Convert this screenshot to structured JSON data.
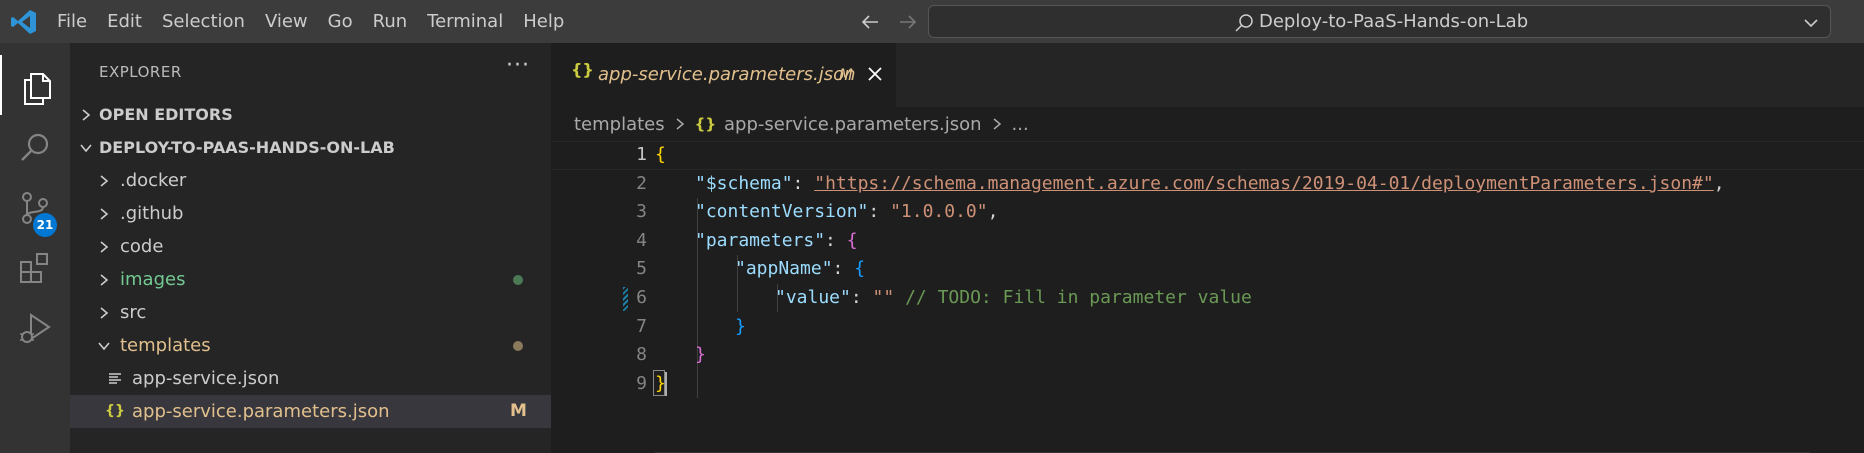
{
  "menu": [
    "File",
    "Edit",
    "Selection",
    "View",
    "Go",
    "Run",
    "Terminal",
    "Help"
  ],
  "command_center": {
    "title": "Deploy-to-PaaS-Hands-on-Lab"
  },
  "activity": {
    "scm_badge": "21"
  },
  "sidebar": {
    "title": "EXPLORER",
    "more": "···",
    "open_editors": "OPEN EDITORS",
    "workspace": "DEPLOY-TO-PAAS-HANDS-ON-LAB",
    "items": [
      {
        "label": ".docker",
        "color": "#cccccc"
      },
      {
        "label": ".github",
        "color": "#cccccc"
      },
      {
        "label": "code",
        "color": "#cccccc"
      },
      {
        "label": "images",
        "color": "#73c991"
      },
      {
        "label": "src",
        "color": "#cccccc"
      },
      {
        "label": "templates",
        "color": "#e2c08d"
      }
    ],
    "files": [
      {
        "label": "app-service.json"
      },
      {
        "label": "app-service.parameters.json",
        "status": "M"
      }
    ]
  },
  "tab": {
    "braces": "{}",
    "label": "app-service.parameters.json",
    "status": "M"
  },
  "breadcrumb": {
    "folder": "templates",
    "braces": "{}",
    "file": "app-service.parameters.json",
    "more": "..."
  },
  "code": {
    "line_numbers": [
      "1",
      "2",
      "3",
      "4",
      "5",
      "6",
      "7",
      "8",
      "9"
    ],
    "l1_open": "{",
    "l2_key": "\"$schema\"",
    "l2_colon": ": ",
    "l2_val": "\"https://schema.management.azure.com/schemas/2019-04-01/deploymentParameters.json#\"",
    "l2_comma": ",",
    "l3_key": "\"contentVersion\"",
    "l3_colon": ": ",
    "l3_val": "\"1.0.0.0\"",
    "l3_comma": ",",
    "l4_key": "\"parameters\"",
    "l4_colon": ": ",
    "l4_open": "{",
    "l5_key": "\"appName\"",
    "l5_colon": ": ",
    "l5_open": "{",
    "l6_key": "\"value\"",
    "l6_colon": ": ",
    "l6_val": "\"\"",
    "l6_comment": " // TODO: Fill in parameter value",
    "l7_close": "}",
    "l8_close": "}",
    "l9_close": "}"
  }
}
